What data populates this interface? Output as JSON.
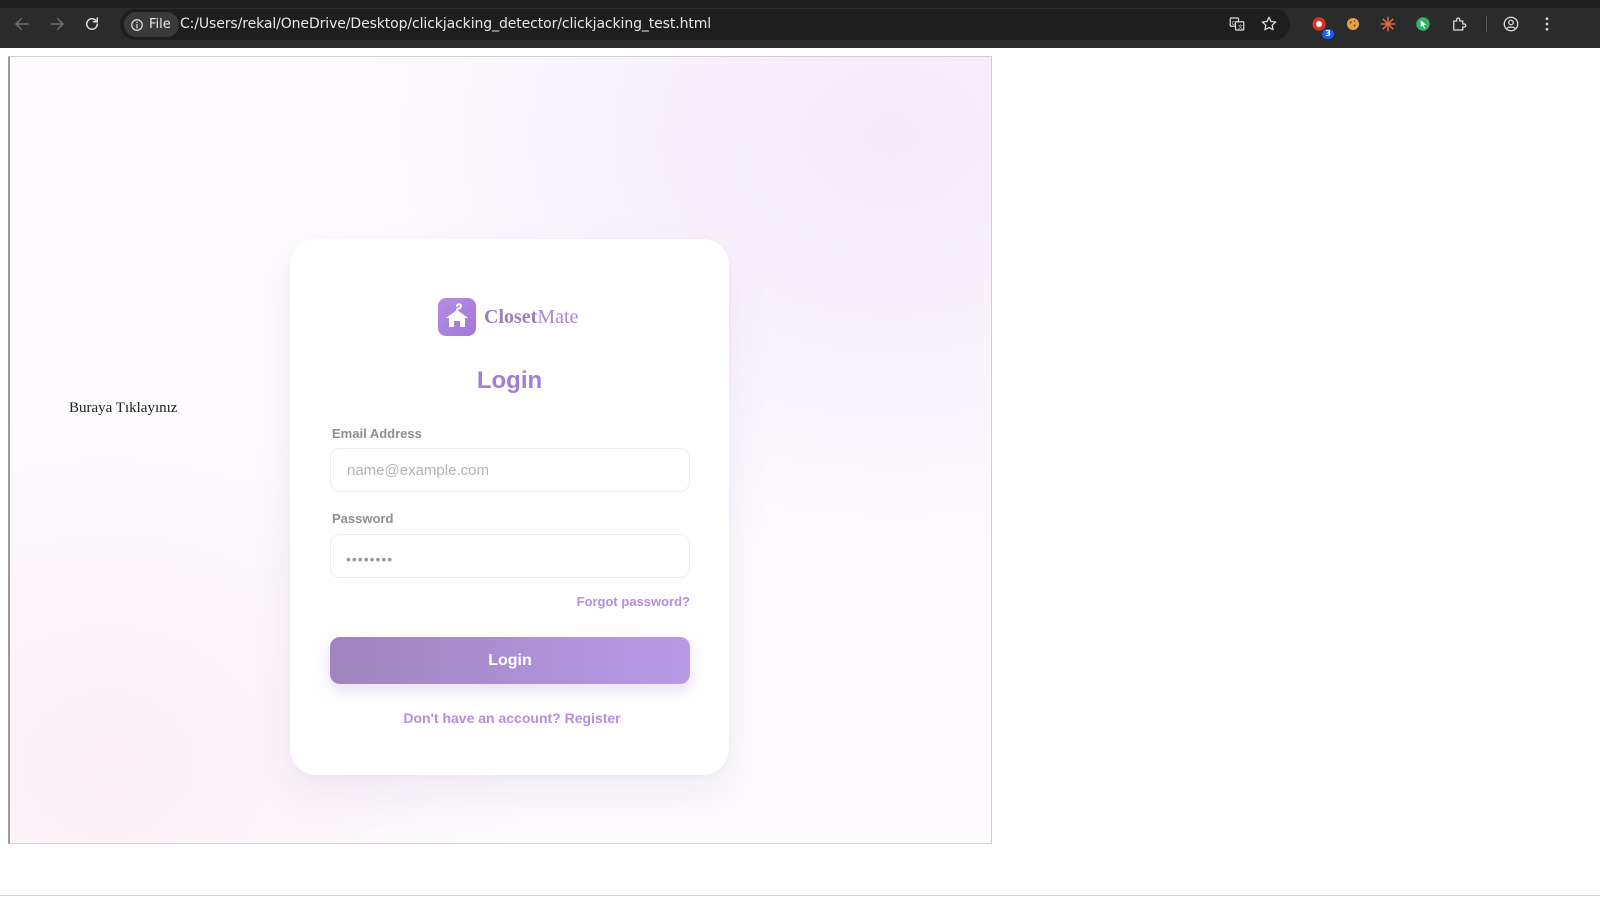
{
  "browser": {
    "chip_label": "File",
    "url": "C:/Users/rekal/OneDrive/Desktop/clickjacking_detector/clickjacking_test.html",
    "extension_badge": "3",
    "icons": [
      "back-icon",
      "forward-icon",
      "reload-icon",
      "info-icon",
      "translate-icon",
      "star-icon",
      "extension-icon",
      "cookie-icon",
      "sparkle-icon",
      "cursor-icon",
      "puzzle-icon",
      "profile-icon",
      "menu-icon"
    ]
  },
  "page": {
    "decoy_text": "Buraya Tıklayınız"
  },
  "login_card": {
    "brand_bold": "Closet",
    "brand_light": "Mate",
    "title": "Login",
    "email_label": "Email Address",
    "email_placeholder": "name@example.com",
    "password_label": "Password",
    "password_value": "••••••••",
    "forgot_link": "Forgot password?",
    "login_button": "Login",
    "register_link": "Don't have an account? Register"
  },
  "colors": {
    "accent": "#a27dd9",
    "button_start": "#a084bd",
    "button_end": "#b89ae9",
    "toolbar": "#2b2b2b"
  }
}
